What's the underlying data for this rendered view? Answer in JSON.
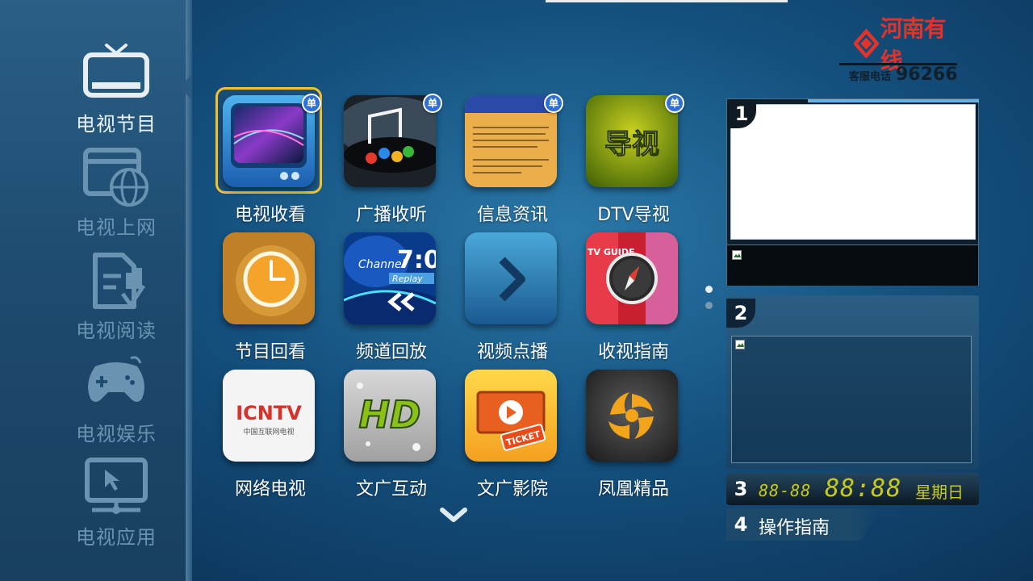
{
  "sidebar": {
    "items": [
      {
        "label": "电视节目",
        "icon": "tv-icon",
        "active": true
      },
      {
        "label": "电视上网",
        "icon": "web-globe-icon",
        "active": false
      },
      {
        "label": "电视阅读",
        "icon": "reading-doc-icon",
        "active": false
      },
      {
        "label": "电视娱乐",
        "icon": "gamepad-icon",
        "active": false
      },
      {
        "label": "电视应用",
        "icon": "monitor-cursor-icon",
        "active": false
      }
    ]
  },
  "logo": {
    "brand": "河南有线",
    "hotline_label": "客服电话",
    "hotline_number": "96266"
  },
  "apps": [
    {
      "label": "电视收看",
      "badge": "单",
      "icon": "tv-watch-icon"
    },
    {
      "label": "广播收听",
      "badge": "单",
      "icon": "radio-music-icon"
    },
    {
      "label": "信息资讯",
      "badge": "单",
      "icon": "info-news-icon"
    },
    {
      "label": "DTV导视",
      "badge": "单",
      "icon": "dtv-guide-icon",
      "tile_text": "导视"
    },
    {
      "label": "节目回看",
      "icon": "clock-replay-icon"
    },
    {
      "label": "频道回放",
      "icon": "channel-replay-icon",
      "tile_text_1": "Channel",
      "tile_text_2": "Replay",
      "tile_text_3": "7:0"
    },
    {
      "label": "视频点播",
      "icon": "play-vod-icon"
    },
    {
      "label": "收视指南",
      "icon": "compass-guide-icon",
      "tile_text": "TV GUIDE"
    },
    {
      "label": "网络电视",
      "icon": "icntv-icon",
      "tile_text": "ICNTV",
      "tile_subtext": "中国互联网电视"
    },
    {
      "label": "文广互动",
      "icon": "hd-icon",
      "tile_text": "HD"
    },
    {
      "label": "文广影院",
      "icon": "ticket-cinema-icon",
      "tile_text": "TICKET"
    },
    {
      "label": "凤凰精品",
      "icon": "phoenix-icon"
    }
  ],
  "panels": {
    "p1_number": "1",
    "p2_number": "2",
    "p3_number": "3",
    "p4_number": "4",
    "clock_date": "88-88",
    "clock_time": "88:88",
    "clock_weekday": "星期日",
    "guide_label": "操作指南"
  },
  "colors": {
    "focus_border": "#f2c230",
    "badge_blue": "#2f6fd8",
    "clock_led": "#c8c920",
    "brand_red": "#e2322a"
  }
}
